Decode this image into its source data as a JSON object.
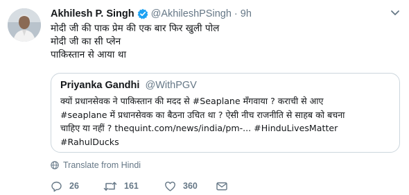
{
  "tweet": {
    "author_name": "Akhilesh P. Singh",
    "author_handle": "@AkhileshPSingh",
    "separator": "·",
    "time": "9h",
    "text_lines": [
      "मोदी जी की पाक प्रेम की एक बार फिर खुली पोल",
      "मोदी जी का सी प्लेन",
      "पाकिस्तान से आया था"
    ],
    "quoted": {
      "author_name": "Priyanka Gandhi",
      "author_handle": "@WithPGV",
      "text_lines": [
        "क्यों प्रधानसेवक ने पाकिस्तान की मदद से #Seaplane मँगवाया ? कराची से आए",
        "#seaplane में प्रधानसेवक का बैठना उचित था ? ऐसी नीच राजनीति से साहब को बचना",
        "चाहिए या नहीं ? thequint.com/news/india/pm-... #HinduLivesMatter",
        "#RahulDucks"
      ]
    },
    "translate_label": "Translate from Hindi",
    "reply_count": "26",
    "retweet_count": "161",
    "like_count": "360"
  },
  "colors": {
    "text": "#14171a",
    "secondary": "#657786",
    "verified": "#1da1f2",
    "border": "#ccd6dd"
  },
  "icons": [
    "verified-badge-icon",
    "caret-down-icon",
    "globe-icon",
    "reply-icon",
    "retweet-icon",
    "heart-icon",
    "direct-message-icon"
  ]
}
